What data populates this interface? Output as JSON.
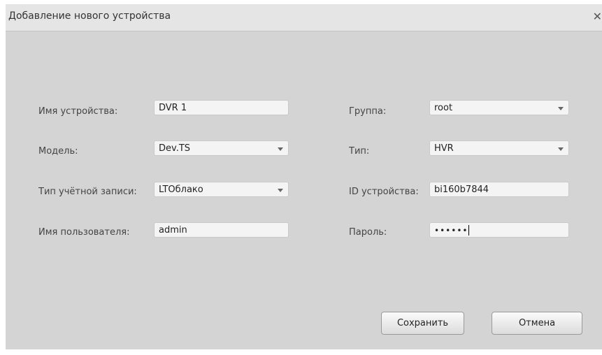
{
  "dialog": {
    "title": "Добавление нового устройства",
    "close_glyph": "✕"
  },
  "form": {
    "device_name": {
      "label": "Имя устройства:",
      "value": "DVR 1"
    },
    "group": {
      "label": "Группа:",
      "value": "root"
    },
    "model": {
      "label": "Модель:",
      "value": "Dev.TS"
    },
    "type": {
      "label": "Тип:",
      "value": "HVR"
    },
    "account_type": {
      "label": "Тип учётной записи:",
      "value": "LTOблако"
    },
    "device_id": {
      "label": "ID устройства:",
      "value": "bi160b7844"
    },
    "username": {
      "label": "Имя пользователя:",
      "value": "admin"
    },
    "password": {
      "label": "Пароль:",
      "masked": "••••••"
    }
  },
  "buttons": {
    "save": "Сохранить",
    "cancel": "Отмена"
  }
}
